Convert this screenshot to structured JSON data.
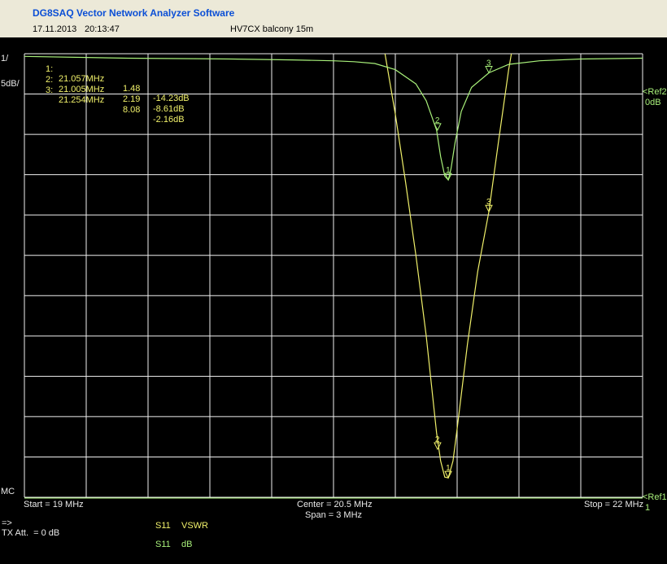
{
  "window": {
    "title": "DG8SAQ Vector Network Analyzer Software",
    "date": "17.11.2013",
    "time": "20:13:47",
    "caption": "HV7CX balcony 15m"
  },
  "scale": {
    "top_left": "1/",
    "db_per_div": "5dB/",
    "bottom_left": "MC"
  },
  "refs": {
    "ref2_label": "<Ref2",
    "ref2_value": "0dB",
    "ref1_label": "<Ref1",
    "ref1_value": "1"
  },
  "markers": [
    {
      "id": "1:",
      "freq": "21.057MHz",
      "vswr": "1.48",
      "db": "-14.23dB"
    },
    {
      "id": "2:",
      "freq": "21.005MHz",
      "vswr": "2.19",
      "db": "-8.61dB"
    },
    {
      "id": "3:",
      "freq": "21.254MHz",
      "vswr": "8.08",
      "db": "-2.16dB"
    }
  ],
  "footer": {
    "start": "Start = 19 MHz",
    "center": "Center = 20.5 MHz",
    "span": "Span = 3 MHz",
    "stop": "Stop = 22 MHz",
    "arrow": "=>",
    "tx_att": "TX Att.  = 0 dB",
    "trace1_param": "S11",
    "trace1_format": "VSWR",
    "trace2_param": "S11",
    "trace2_format": "dB"
  },
  "colors": {
    "background": "#000000",
    "grid": "#f0f0f0",
    "vswr_trace": "#f0f06a",
    "db_trace": "#a8f07a"
  },
  "chart_data": {
    "type": "line",
    "x_unit": "MHz",
    "xlim": [
      19,
      22
    ],
    "grid": true,
    "series": [
      {
        "format": "VSWR",
        "ylim": [
          1,
          12
        ],
        "x": [
          20.75,
          20.8,
          20.85,
          20.9,
          20.95,
          21.0,
          21.02,
          21.04,
          21.057,
          21.08,
          21.1,
          21.15,
          21.2,
          21.254,
          21.3,
          21.35,
          21.38
        ],
        "values": [
          12,
          10.5,
          8.8,
          7.0,
          5.0,
          2.6,
          1.9,
          1.5,
          1.48,
          1.9,
          2.7,
          4.8,
          6.6,
          8.08,
          9.8,
          11.6,
          12.5
        ]
      },
      {
        "format": "dB",
        "ylim": [
          -50,
          0
        ],
        "x": [
          19.0,
          19.5,
          20.0,
          20.3,
          20.5,
          20.6,
          20.7,
          20.8,
          20.9,
          20.95,
          21.0,
          21.02,
          21.04,
          21.057,
          21.07,
          21.09,
          21.12,
          21.17,
          21.254,
          21.35,
          21.5,
          21.7,
          22.0
        ],
        "values": [
          -0.3,
          -0.5,
          -0.6,
          -0.7,
          -0.8,
          -0.9,
          -1.1,
          -1.8,
          -3.4,
          -5.3,
          -8.61,
          -11.6,
          -13.8,
          -14.23,
          -13.0,
          -10.0,
          -6.5,
          -3.8,
          -2.16,
          -1.2,
          -0.8,
          -0.6,
          -0.5
        ]
      }
    ],
    "markers": [
      {
        "label": "1",
        "x": 21.057,
        "vswr": 1.48,
        "db": -14.23
      },
      {
        "label": "2",
        "x": 21.005,
        "vswr": 2.19,
        "db": -8.61
      },
      {
        "label": "3",
        "x": 21.254,
        "vswr": 8.08,
        "db": -2.16
      }
    ]
  }
}
